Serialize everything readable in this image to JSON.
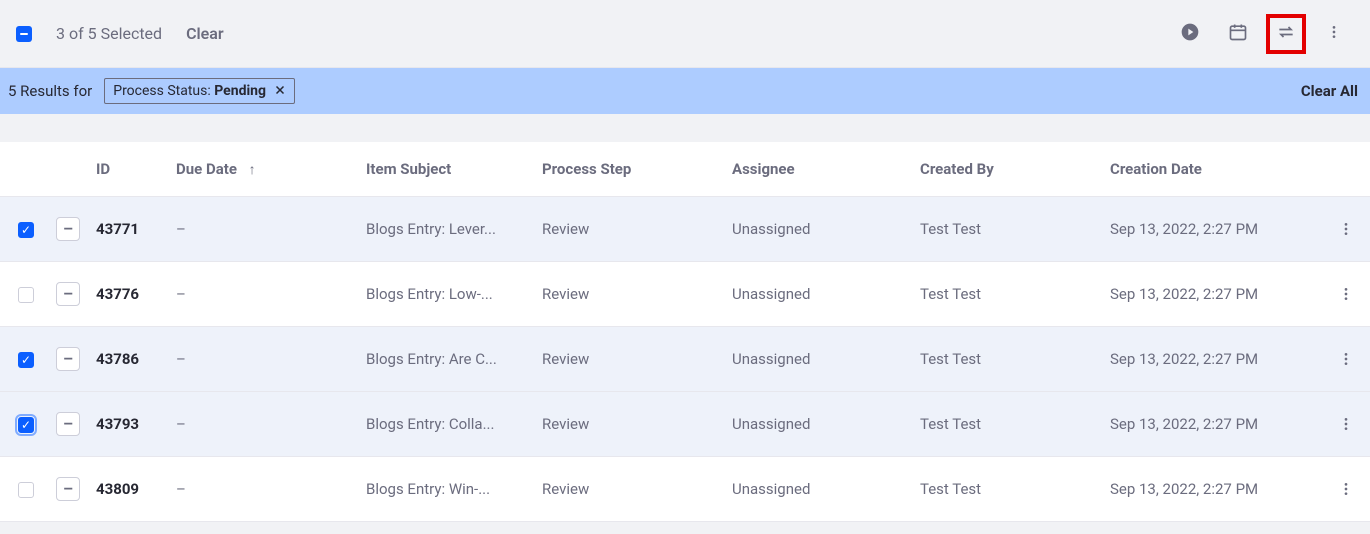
{
  "selection": {
    "count_text": "3 of 5 Selected",
    "clear_label": "Clear"
  },
  "filter": {
    "results_for_prefix": "5 Results for",
    "chip_label": "Process Status: ",
    "chip_value": "Pending",
    "clear_all_label": "Clear All"
  },
  "columns": {
    "id": "ID",
    "due": "Due Date",
    "subject": "Item Subject",
    "step": "Process Step",
    "assignee": "Assignee",
    "created_by": "Created By",
    "creation_date": "Creation Date"
  },
  "rows": [
    {
      "checked": true,
      "focused": false,
      "id": "43771",
      "due": "–",
      "subject": "Blogs Entry: Lever...",
      "step": "Review",
      "assignee": "Unassigned",
      "created_by": "Test Test",
      "date": "Sep 13, 2022, 2:27 PM"
    },
    {
      "checked": false,
      "focused": false,
      "id": "43776",
      "due": "–",
      "subject": "Blogs Entry: Low-...",
      "step": "Review",
      "assignee": "Unassigned",
      "created_by": "Test Test",
      "date": "Sep 13, 2022, 2:27 PM"
    },
    {
      "checked": true,
      "focused": false,
      "id": "43786",
      "due": "–",
      "subject": "Blogs Entry: Are C...",
      "step": "Review",
      "assignee": "Unassigned",
      "created_by": "Test Test",
      "date": "Sep 13, 2022, 2:27 PM"
    },
    {
      "checked": true,
      "focused": true,
      "id": "43793",
      "due": "–",
      "subject": "Blogs Entry: Colla...",
      "step": "Review",
      "assignee": "Unassigned",
      "created_by": "Test Test",
      "date": "Sep 13, 2022, 2:27 PM"
    },
    {
      "checked": false,
      "focused": false,
      "id": "43809",
      "due": "–",
      "subject": "Blogs Entry: Win-...",
      "step": "Review",
      "assignee": "Unassigned",
      "created_by": "Test Test",
      "date": "Sep 13, 2022, 2:27 PM"
    }
  ]
}
